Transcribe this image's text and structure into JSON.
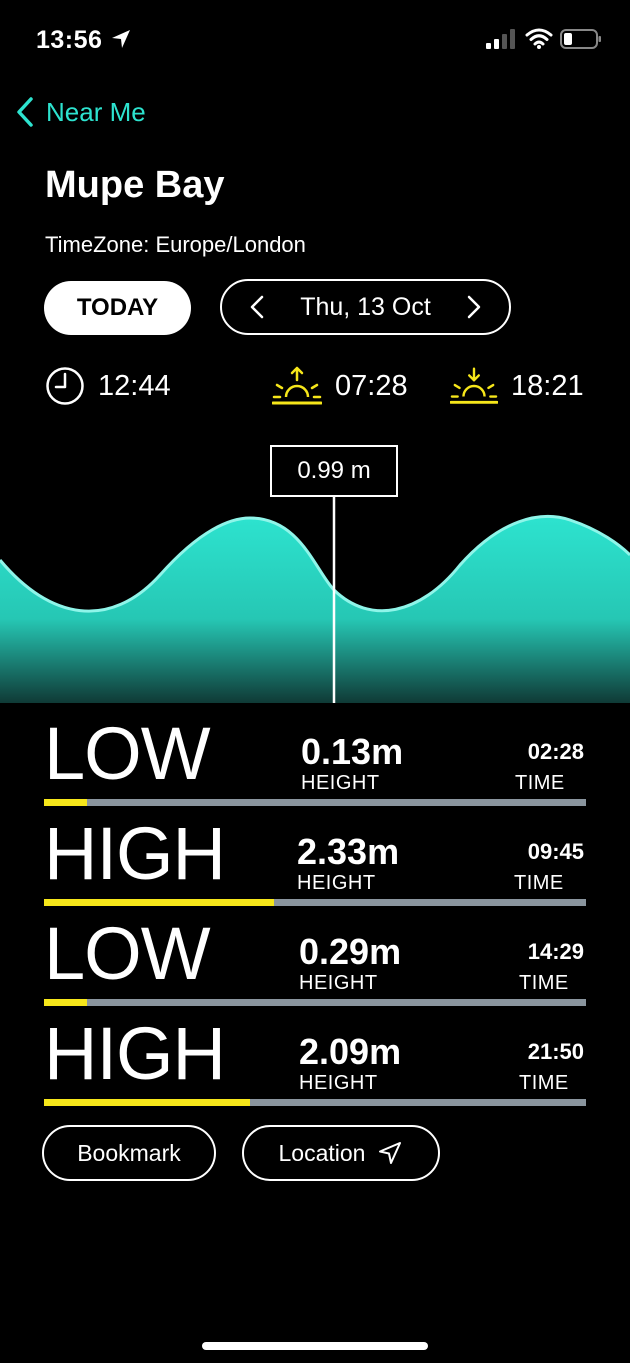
{
  "colors": {
    "accent": "#2de3cf",
    "sun": "#f6e61a",
    "bar_track": "#8a959e",
    "bar_fill": "#f6e61a"
  },
  "status_bar": {
    "time": "13:56",
    "icons": [
      "location-arrow-icon",
      "cellular-signal-icon",
      "wifi-icon",
      "battery-icon"
    ]
  },
  "nav": {
    "back_label": "Near Me"
  },
  "location": {
    "name": "Mupe Bay",
    "timezone": "TimeZone: Europe/London"
  },
  "date_controls": {
    "today_label": "TODAY",
    "date_label": "Thu, 13 Oct"
  },
  "day_info": {
    "current_time": "12:44",
    "sunrise": "07:28",
    "sunset": "18:21"
  },
  "chart_data": {
    "type": "area",
    "marker_label": "0.99 m",
    "marker_value": 0.99,
    "unit": "m"
  },
  "tides": [
    {
      "type": "LOW",
      "height": "0.13m",
      "height_value": 0.13,
      "height_label": "HEIGHT",
      "time": "02:28",
      "time_label": "TIME"
    },
    {
      "type": "HIGH",
      "height": "2.33m",
      "height_value": 2.33,
      "height_label": "HEIGHT",
      "time": "09:45",
      "time_label": "TIME"
    },
    {
      "type": "LOW",
      "height": "0.29m",
      "height_value": 0.29,
      "height_label": "HEIGHT",
      "time": "14:29",
      "time_label": "TIME"
    },
    {
      "type": "HIGH",
      "height": "2.09m",
      "height_value": 2.09,
      "height_label": "HEIGHT",
      "time": "21:50",
      "time_label": "TIME"
    }
  ],
  "tide_bar_max": 5.5,
  "actions": {
    "bookmark_label": "Bookmark",
    "location_label": "Location"
  }
}
